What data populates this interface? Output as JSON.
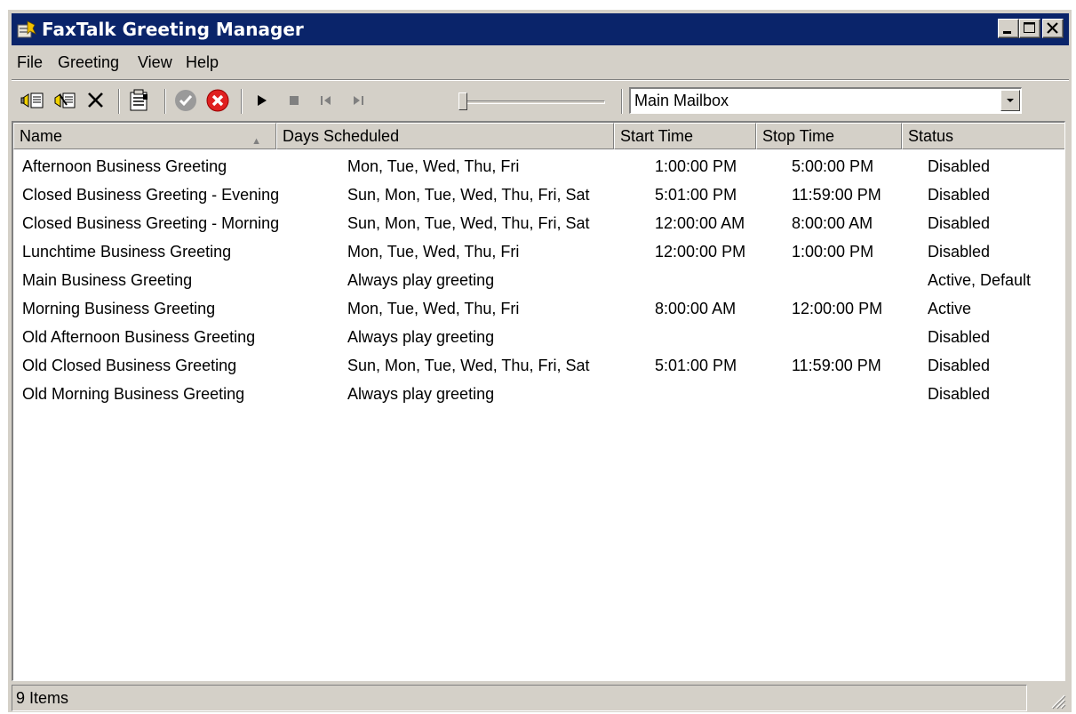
{
  "window": {
    "title": "FaxTalk Greeting Manager",
    "title_bar_color": "#0a246a",
    "chrome_color": "#d4d0c8",
    "icons": [
      "app-icon",
      "minimize-icon",
      "maximize-icon",
      "close-icon"
    ]
  },
  "menu": {
    "items": [
      "File",
      "Greeting",
      "View",
      "Help"
    ]
  },
  "toolbar": {
    "icons": [
      "new-greeting-icon",
      "edit-greeting-icon",
      "delete-icon",
      "properties-icon",
      "activate-icon",
      "deactivate-icon",
      "play-icon",
      "stop-icon",
      "previous-icon",
      "next-icon",
      "position-slider"
    ],
    "slider_position": 0,
    "mailbox": {
      "selected": "Main Mailbox"
    }
  },
  "list": {
    "columns": [
      "Name",
      "Days Scheduled",
      "Start Time",
      "Stop Time",
      "Status"
    ],
    "sorted_by": "Name",
    "rows": [
      {
        "name": "Afternoon Business Greeting",
        "days": "Mon, Tue, Wed, Thu, Fri",
        "start": "1:00:00 PM",
        "stop": "5:00:00 PM",
        "status": "Disabled"
      },
      {
        "name": "Closed Business Greeting - Evening",
        "days": "Sun, Mon, Tue, Wed, Thu, Fri, Sat",
        "start": "5:01:00 PM",
        "stop": "11:59:00 PM",
        "status": "Disabled"
      },
      {
        "name": "Closed Business Greeting - Morning",
        "days": "Sun, Mon, Tue, Wed, Thu, Fri, Sat",
        "start": "12:00:00 AM",
        "stop": "8:00:00 AM",
        "status": "Disabled"
      },
      {
        "name": "Lunchtime Business Greeting",
        "days": "Mon, Tue, Wed, Thu, Fri",
        "start": "12:00:00 PM",
        "stop": "1:00:00 PM",
        "status": "Disabled"
      },
      {
        "name": "Main Business Greeting",
        "days": "Always play greeting",
        "start": "",
        "stop": "",
        "status": "Active, Default"
      },
      {
        "name": "Morning Business Greeting",
        "days": "Mon, Tue, Wed, Thu, Fri",
        "start": "8:00:00 AM",
        "stop": "12:00:00 PM",
        "status": "Active"
      },
      {
        "name": "Old Afternoon Business Greeting",
        "days": "Always play greeting",
        "start": "",
        "stop": "",
        "status": "Disabled"
      },
      {
        "name": "Old Closed Business Greeting",
        "days": "Sun, Mon, Tue, Wed, Thu, Fri, Sat",
        "start": "5:01:00 PM",
        "stop": "11:59:00 PM",
        "status": "Disabled"
      },
      {
        "name": "Old Morning Business Greeting",
        "days": "Always play greeting",
        "start": "",
        "stop": "",
        "status": "Disabled"
      }
    ]
  },
  "statusbar": {
    "text": "9 Items"
  }
}
